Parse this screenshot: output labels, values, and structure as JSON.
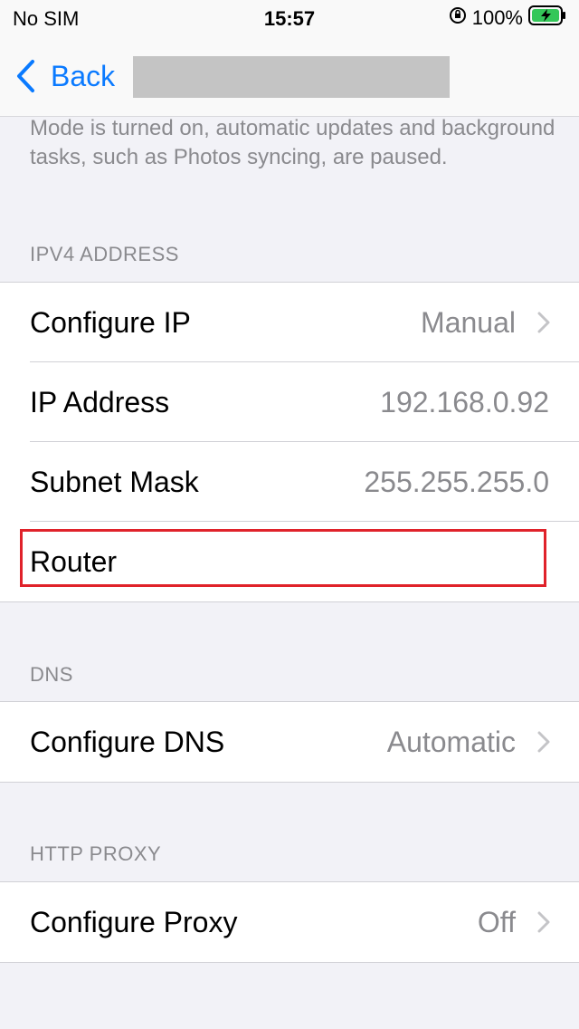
{
  "status_bar": {
    "carrier": "No SIM",
    "time": "15:57",
    "battery_percent": "100%",
    "icons": [
      "orientation-lock-icon",
      "battery-charging-icon"
    ]
  },
  "nav": {
    "back_label": "Back",
    "title_redacted": true
  },
  "footer_note": "Mode is turned on, automatic updates and background tasks, such as Photos syncing, are paused.",
  "sections": {
    "ipv4": {
      "header": "IPV4 ADDRESS",
      "configure_ip": {
        "label": "Configure IP",
        "value": "Manual"
      },
      "ip_address": {
        "label": "IP Address",
        "value": "192.168.0.92"
      },
      "subnet_mask": {
        "label": "Subnet Mask",
        "value": "255.255.255.0"
      },
      "router": {
        "label": "Router",
        "value": ""
      }
    },
    "dns": {
      "header": "DNS",
      "configure_dns": {
        "label": "Configure DNS",
        "value": "Automatic"
      }
    },
    "proxy": {
      "header": "HTTP PROXY",
      "configure_proxy": {
        "label": "Configure Proxy",
        "value": "Off"
      }
    }
  },
  "colors": {
    "accent": "#0a7aff",
    "highlight": "#e0222a",
    "battery_fill": "#34c759"
  }
}
